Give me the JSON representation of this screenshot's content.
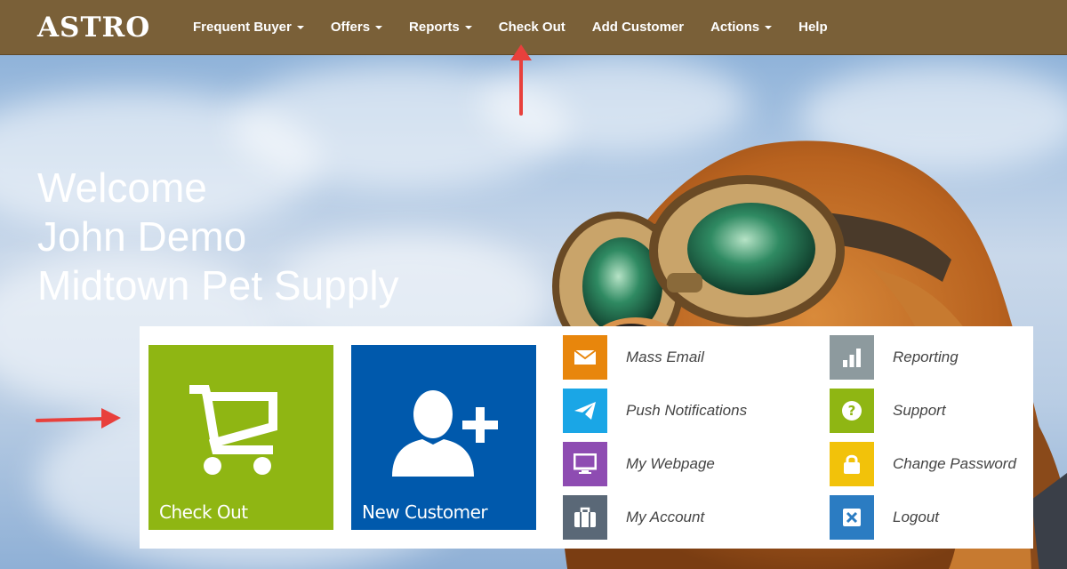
{
  "brand": {
    "logo": "ASTRO"
  },
  "nav": {
    "items": [
      {
        "label": "Frequent Buyer",
        "dropdown": true
      },
      {
        "label": "Offers",
        "dropdown": true
      },
      {
        "label": "Reports",
        "dropdown": true
      },
      {
        "label": "Check Out",
        "dropdown": false
      },
      {
        "label": "Add Customer",
        "dropdown": false
      },
      {
        "label": "Actions",
        "dropdown": true
      },
      {
        "label": "Help",
        "dropdown": false
      }
    ]
  },
  "welcome": {
    "line1": "Welcome",
    "line2": "John Demo",
    "line3": "Midtown Pet Supply"
  },
  "tiles": {
    "checkout": {
      "label": "Check Out",
      "color": "#8fb613",
      "icon": "shopping-cart-icon"
    },
    "new_customer": {
      "label": "New Customer",
      "color": "#0059ac",
      "icon": "add-user-icon"
    }
  },
  "links": {
    "mass_email": {
      "label": "Mass Email",
      "color": "#e8860c",
      "icon": "envelope-icon"
    },
    "push_notifications": {
      "label": "Push Notifications",
      "color": "#1aa6e6",
      "icon": "paper-plane-icon"
    },
    "my_webpage": {
      "label": "My Webpage",
      "color": "#8e4cb2",
      "icon": "monitor-icon"
    },
    "my_account": {
      "label": "My Account",
      "color": "#5a6877",
      "icon": "briefcase-icon"
    },
    "reporting": {
      "label": "Reporting",
      "color": "#8d9a9e",
      "icon": "bar-chart-icon"
    },
    "support": {
      "label": "Support",
      "color": "#8fb613",
      "icon": "question-icon"
    },
    "change_password": {
      "label": "Change Password",
      "color": "#f2c20a",
      "icon": "lock-icon"
    },
    "logout": {
      "label": "Logout",
      "color": "#2b7cc2",
      "icon": "close-icon"
    }
  },
  "annotations": {
    "arrow_color": "#e8403c"
  }
}
